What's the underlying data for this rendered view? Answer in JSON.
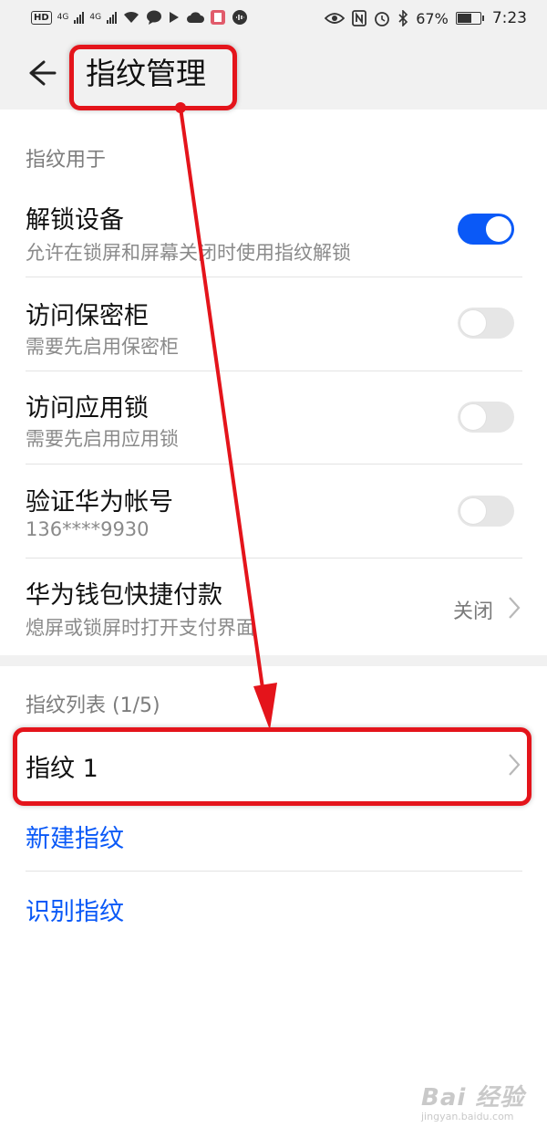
{
  "status_bar": {
    "hd_label": "HD",
    "network_1": "4G",
    "network_2": "4G",
    "battery_percent": "67%",
    "time": "7:23",
    "battery_level": 0.67,
    "icons": [
      "hd-icon",
      "signal-icon",
      "wifi-icon",
      "chat-icon",
      "video-app-icon",
      "cloud-icon",
      "book-app-icon",
      "voice-icon",
      "eye-icon",
      "nfc-icon",
      "alarm-icon",
      "bluetooth-icon",
      "battery-icon"
    ]
  },
  "header": {
    "title": "指纹管理",
    "back_icon": "arrow-left-icon"
  },
  "usage_section": {
    "label": "指纹用于",
    "items": [
      {
        "title": "解锁设备",
        "subtitle": "允许在锁屏和屏幕关闭时使用指纹解锁",
        "switch": "on"
      },
      {
        "title": "访问保密柜",
        "subtitle": "需要先启用保密柜",
        "switch": "off"
      },
      {
        "title": "访问应用锁",
        "subtitle": "需要先启用应用锁",
        "switch": "off"
      },
      {
        "title": "验证华为帐号",
        "subtitle": "136****9930",
        "switch": "off"
      },
      {
        "title": "华为钱包快捷付款",
        "subtitle": "熄屏或锁屏时打开支付界面",
        "value": "关闭"
      }
    ]
  },
  "fingerprint_section": {
    "label": "指纹列表 (1/5)",
    "items": [
      {
        "title": "指纹 1"
      }
    ],
    "actions": {
      "new": "新建指纹",
      "identify": "识别指纹"
    }
  },
  "colors": {
    "accent": "#0a59f7",
    "annotation": "#e4141b",
    "background": "#ffffff",
    "header_bg": "#f1f1f1"
  },
  "watermark": {
    "main": "Bai 经验",
    "sub": "jingyan.baidu.com"
  }
}
